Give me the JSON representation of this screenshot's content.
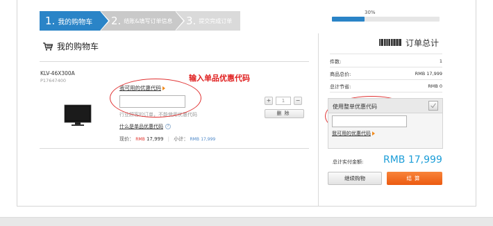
{
  "steps": [
    {
      "num": "1.",
      "label": "我的购物车"
    },
    {
      "num": "2.",
      "label": "结账&填写订单信息"
    },
    {
      "num": "3.",
      "label": "提交完成订单"
    }
  ],
  "progress": {
    "label": "30%",
    "value": 0.3,
    "color": "#2a84c7"
  },
  "cart": {
    "title": "我的购物车",
    "product": {
      "name": "KLV-46X300A",
      "code": "P17647400",
      "coupon_link": "我可用的优惠代码",
      "coupon_placeholder": "",
      "note": "行业顾客的订单，不能使用优惠代码",
      "what_link": "什么是单品优惠代码",
      "help_icon": "?",
      "price_label": "现价：",
      "price_currency": "RMB",
      "price_value": "17,999",
      "subtotal_label": "小计：",
      "subtotal_currency": "RMB",
      "subtotal_value": "17,999",
      "qty_minus": "−",
      "qty_plus": "+",
      "qty_value": "1",
      "delete_label": "删除"
    }
  },
  "annotation": {
    "text": "输入单品优惠代码",
    "color": "#e02020"
  },
  "summary": {
    "title": "订单总计",
    "rows": [
      {
        "label": "件数:",
        "value": "1"
      },
      {
        "label": "商品总价:",
        "value": "RMB 17,999"
      },
      {
        "label": "总计节省:",
        "value": "RMB 0"
      }
    ],
    "coupon_box_label": "使用整单优惠代码",
    "coupon_box_link": "我可用的优惠代码",
    "total_label": "总计实付金额:",
    "total_value": "RMB 17,999",
    "continue_label": "继续购物",
    "checkout_label": "结算"
  },
  "colors": {
    "accent": "#2a84c7",
    "price_red": "#e0302a",
    "total_blue": "#1d9ed8",
    "checkout_orange": "#ec5a10"
  }
}
